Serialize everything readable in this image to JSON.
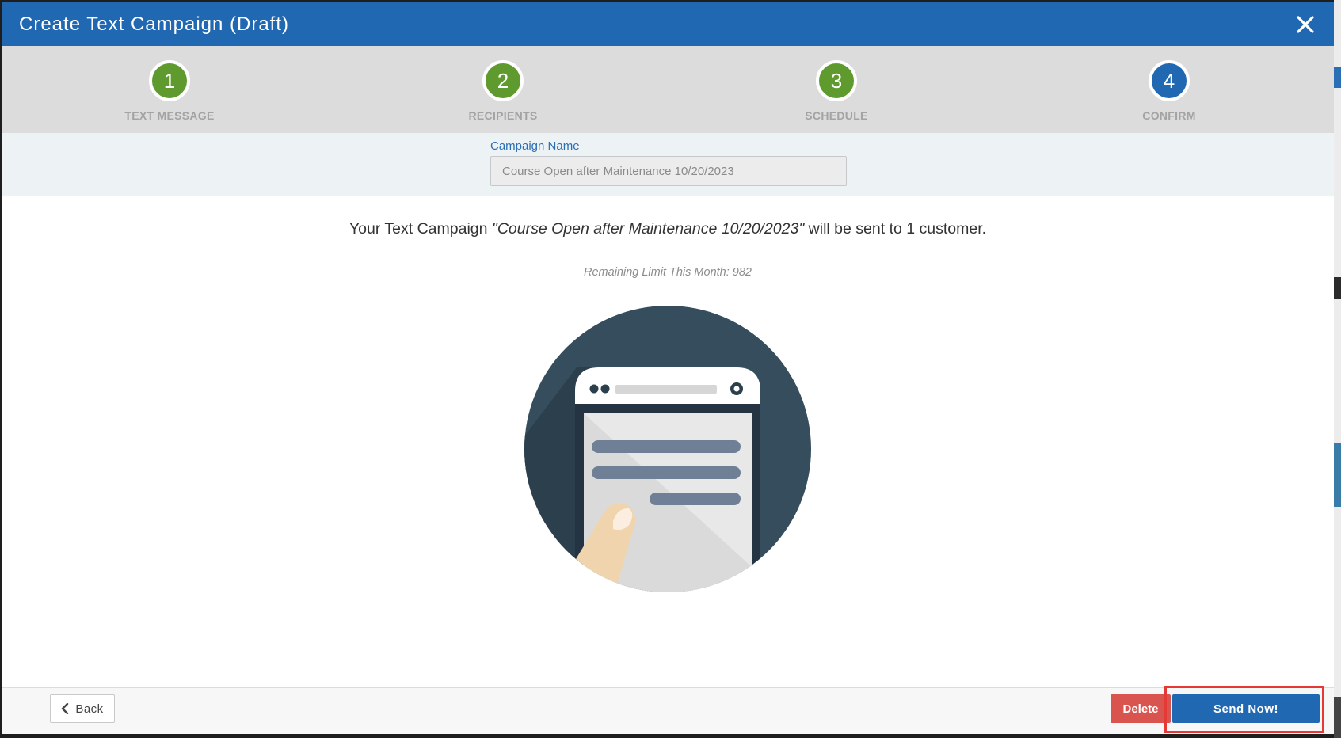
{
  "modal": {
    "title": "Create Text Campaign (Draft)"
  },
  "steps": [
    {
      "number": "1",
      "label": "TEXT MESSAGE",
      "state": "done"
    },
    {
      "number": "2",
      "label": "RECIPIENTS",
      "state": "done"
    },
    {
      "number": "3",
      "label": "SCHEDULE",
      "state": "done"
    },
    {
      "number": "4",
      "label": "CONFIRM",
      "state": "active"
    }
  ],
  "campaign": {
    "name_label": "Campaign Name",
    "name_value": "Course Open after Maintenance 10/20/2023"
  },
  "summary": {
    "prefix": "Your Text Campaign ",
    "campaign_name_quoted": "\"Course Open after Maintenance 10/20/2023\"",
    "suffix": " will be sent to 1 customer.",
    "remaining_limit": "Remaining Limit This Month: 982"
  },
  "footer": {
    "back_label": "Back",
    "delete_label": "Delete",
    "send_label": "Send Now!"
  },
  "colors": {
    "header_blue": "#2068b2",
    "step_done_green": "#5f9a2e",
    "delete_red": "#d9534f",
    "highlight_red": "#e53935"
  },
  "icons": {
    "close": "close-icon",
    "back": "chevron-left-icon",
    "illustration": "phone-sms-illustration"
  }
}
